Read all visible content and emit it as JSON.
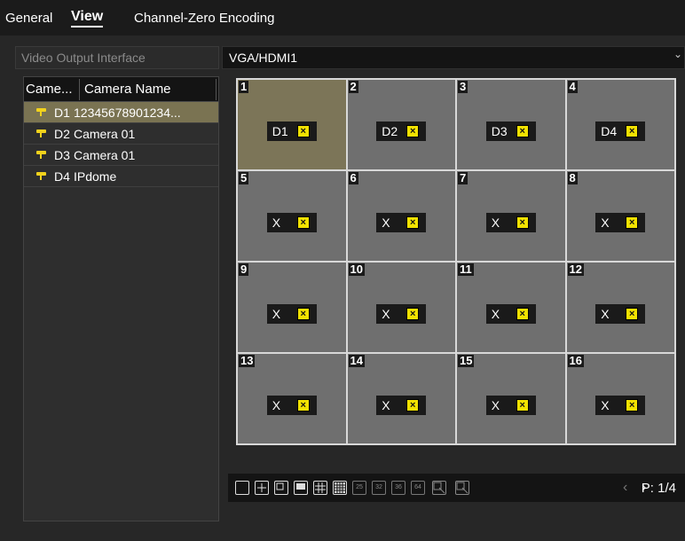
{
  "tabs": [
    {
      "label": "General",
      "active": false
    },
    {
      "label": "View",
      "active": true
    },
    {
      "label": "Channel-Zero Encoding",
      "active": false
    }
  ],
  "video_output": {
    "label": "Video Output Interface",
    "value": "VGA/HDMI1"
  },
  "camera_table": {
    "headers": {
      "col1": "Came...",
      "col2": "Camera Name"
    },
    "rows": [
      {
        "id": "D1",
        "name": "12345678901234...",
        "selected": true
      },
      {
        "id": "D2",
        "name": "Camera 01",
        "selected": false
      },
      {
        "id": "D3",
        "name": "Camera 01",
        "selected": false
      },
      {
        "id": "D4",
        "name": "IPdome",
        "selected": false
      }
    ]
  },
  "grid": {
    "cells": [
      {
        "num": "1",
        "label": "D1"
      },
      {
        "num": "2",
        "label": "D2"
      },
      {
        "num": "3",
        "label": "D3"
      },
      {
        "num": "4",
        "label": "D4"
      },
      {
        "num": "5",
        "label": "X"
      },
      {
        "num": "6",
        "label": "X"
      },
      {
        "num": "7",
        "label": "X"
      },
      {
        "num": "8",
        "label": "X"
      },
      {
        "num": "9",
        "label": "X"
      },
      {
        "num": "10",
        "label": "X"
      },
      {
        "num": "11",
        "label": "X"
      },
      {
        "num": "12",
        "label": "X"
      },
      {
        "num": "13",
        "label": "X"
      },
      {
        "num": "14",
        "label": "X"
      },
      {
        "num": "15",
        "label": "X"
      },
      {
        "num": "16",
        "label": "X"
      }
    ],
    "selected_cell": "1",
    "remove_glyph": "×"
  },
  "layout_bar": {
    "buttons": [
      {
        "name": "layout-1-button"
      },
      {
        "name": "layout-4-button"
      },
      {
        "name": "layout-6-button"
      },
      {
        "name": "layout-8-button"
      },
      {
        "name": "layout-9-button"
      },
      {
        "name": "layout-16-button"
      },
      {
        "name": "layout-25-button",
        "text": "25"
      },
      {
        "name": "layout-32-button",
        "text": "32"
      },
      {
        "name": "layout-36-button",
        "text": "36"
      },
      {
        "name": "layout-64-button",
        "text": "64"
      },
      {
        "name": "start-live-view-button"
      },
      {
        "name": "stop-live-view-button"
      }
    ],
    "prev_arrow": "‹",
    "next_arrow": "›",
    "page": "P: 1/4"
  },
  "colors": {
    "selected_cell": "#7c7558",
    "selected_row": "#7a7352",
    "remove_icon": "#f2e200",
    "camera_icon": "#f2d21c"
  }
}
